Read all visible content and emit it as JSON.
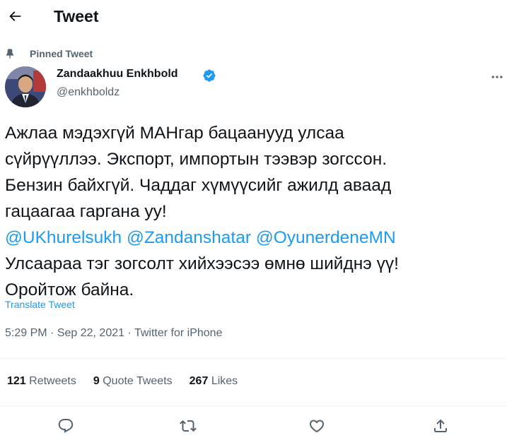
{
  "header": {
    "title": "Tweet",
    "back_icon": "back-arrow-icon"
  },
  "pinned": {
    "label": "Pinned Tweet",
    "icon": "pin-icon"
  },
  "author": {
    "name": "Zandaakhuu Enkhbold",
    "handle": "@enkhboldz",
    "verified": true,
    "verified_icon": "verified-badge-icon"
  },
  "tweet": {
    "lines": [
      "Ажлаа мэдэхгүй МАНгар бацаанууд улсаа",
      "сүйрүүллээ. Экспорт, импортын тээвэр зогссон.",
      "Бензин байхгүй. Чаддаг хүмүүсийг ажилд аваад",
      "гацаагаа гаргана уу!"
    ],
    "mentions": [
      "@UKhurelsukh",
      "@Zandanshatar",
      "@OyunerdeneMN"
    ],
    "closing_lines": [
      "Улсаараа тэг зогсолт хийхээсээ өмнө шийднэ үү!",
      "Оройтож байна."
    ],
    "translate_label": "Translate Tweet"
  },
  "meta": {
    "time": "5:29 PM",
    "separator": "·",
    "date": "Sep 22, 2021",
    "source": "Twitter for iPhone"
  },
  "stats": {
    "retweets": {
      "count": "121",
      "label": "Retweets"
    },
    "quotes": {
      "count": "9",
      "label": "Quote Tweets"
    },
    "likes": {
      "count": "267",
      "label": "Likes"
    }
  },
  "actions": [
    "reply-icon",
    "retweet-icon",
    "like-icon",
    "share-icon"
  ],
  "colors": {
    "text": "#0f1419",
    "secondary": "#536471",
    "accent": "#1d9bf0",
    "divider": "#eff3f4"
  }
}
